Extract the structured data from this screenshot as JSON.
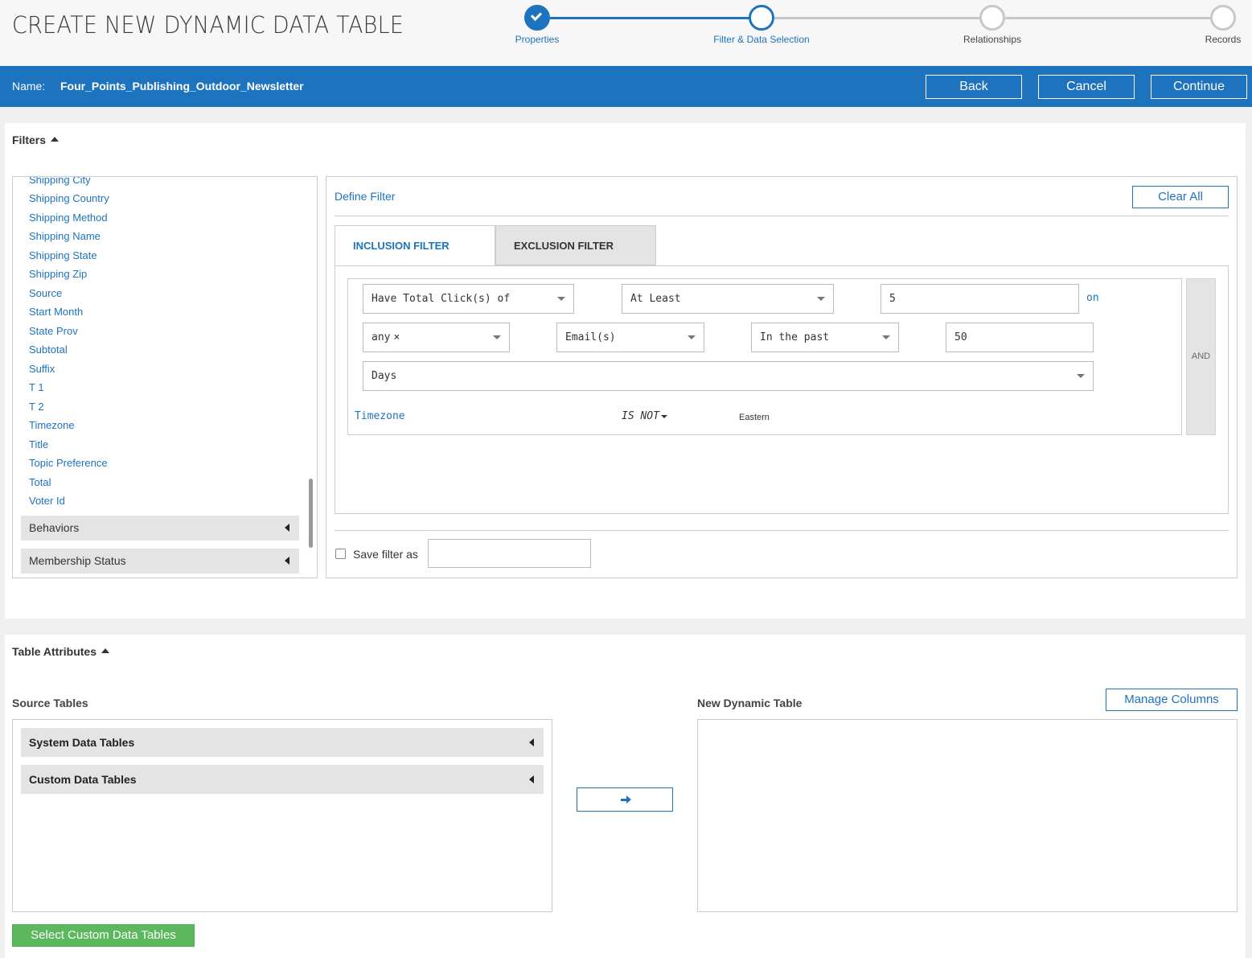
{
  "header": {
    "title": "CREATE NEW DYNAMIC DATA TABLE",
    "steps": [
      {
        "label": "Properties",
        "state": "done"
      },
      {
        "label": "Filter & Data Selection",
        "state": "active"
      },
      {
        "label": "Relationships",
        "state": "todo"
      },
      {
        "label": "Records",
        "state": "todo"
      }
    ]
  },
  "namebar": {
    "name_label": "Name:",
    "name_value": "Four_Points_Publishing_Outdoor_Newsletter",
    "back_label": "Back",
    "cancel_label": "Cancel",
    "continue_label": "Continue"
  },
  "filters": {
    "section_title": "Filters",
    "fields": [
      "Shipping City",
      "Shipping Country",
      "Shipping Method",
      "Shipping Name",
      "Shipping State",
      "Shipping Zip",
      "Source",
      "Start Month",
      "State Prov",
      "Subtotal",
      "Suffix",
      "T 1",
      "T 2",
      "Timezone",
      "Title",
      "Topic Preference",
      "Total",
      "Voter Id"
    ],
    "groups": [
      "Behaviors",
      "Membership Status"
    ],
    "define_title": "Define Filter",
    "clear_all_label": "Clear All",
    "tabs": [
      "INCLUSION FILTER",
      "EXCLUSION FILTER"
    ],
    "rule": {
      "metric": "Have Total Click(s) of",
      "comparator": "At Least",
      "count": "5",
      "on_label": "on",
      "scope": "any",
      "scope_clear": "×",
      "channel": "Email(s)",
      "time_mode": "In the past",
      "time_value": "50",
      "time_unit": "Days",
      "condition_field": "Timezone",
      "condition_operator": "IS NOT",
      "condition_value": "Eastern",
      "and_label": "AND"
    },
    "save_filter_label": "Save filter as",
    "save_filter_value": ""
  },
  "table_attributes": {
    "section_title": "Table Attributes",
    "source_tables_label": "Source Tables",
    "source_groups": [
      "System Data Tables",
      "Custom Data Tables"
    ],
    "new_table_label": "New Dynamic Table",
    "manage_columns_label": "Manage Columns",
    "select_custom_label": "Select Custom Data Tables"
  },
  "colors": {
    "accent": "#1e73be",
    "inactive_step": "#c8c8c8",
    "green": "#5cb85c",
    "panel_gray": "#e4e4e4"
  },
  "icons": [
    "check-icon",
    "caret-up-icon",
    "caret-left-icon",
    "dropdown-icon",
    "arrow-right-icon"
  ]
}
